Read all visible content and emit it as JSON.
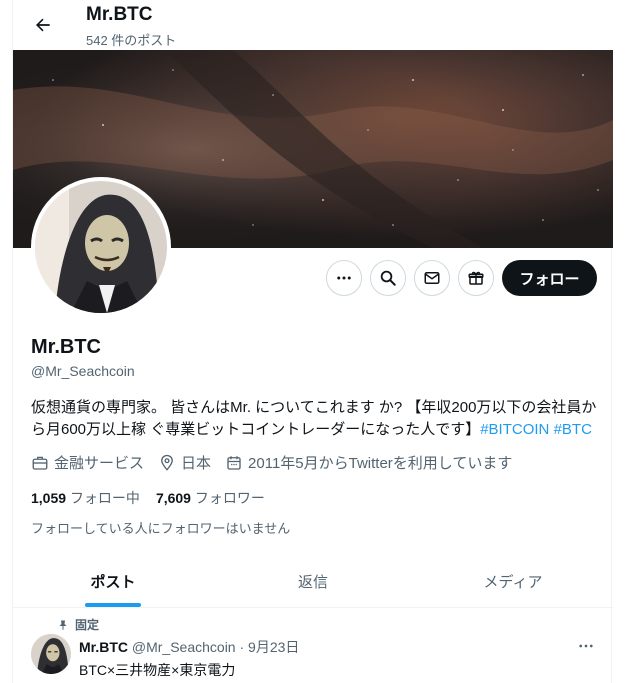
{
  "header": {
    "title": "Mr.BTC",
    "post_count": "542 件のポスト"
  },
  "profile": {
    "name": "Mr.BTC",
    "handle": "@Mr_Seachcoin",
    "bio_text": "仮想通貨の専門家。 皆さんはMr. についてこれます か? 【年収200万以下の会社員から月600万以上稼 ぐ専業ビットコイントレーダーになった人です】",
    "bio_tags": [
      "#BITCOIN",
      "#BTC"
    ],
    "category": "金融サービス",
    "location": "日本",
    "joined": "2011年5月からTwitterを利用しています",
    "following_count": "1,059",
    "following_label": "フォロー中",
    "followers_count": "7,609",
    "followers_label": "フォロワー",
    "followers_note": "フォローしている人にフォロワーはいません"
  },
  "actions": {
    "more_icon": "ellipsis-icon",
    "search_icon": "search-icon",
    "message_icon": "mail-icon",
    "subscribe_icon": "gift-icon",
    "follow_label": "フォロー"
  },
  "tabs": [
    {
      "label": "ポスト",
      "active": true
    },
    {
      "label": "返信",
      "active": false
    },
    {
      "label": "メディア",
      "active": false
    }
  ],
  "pinned_tweet": {
    "pinned_label": "固定",
    "name": "Mr.BTC",
    "handle": "@Mr_Seachcoin",
    "separator": "·",
    "date": "9月23日",
    "text": "BTC×三井物産×東京電力"
  },
  "colors": {
    "accent": "#1d9bf0",
    "text_primary": "#0f1419",
    "text_secondary": "#536471",
    "border": "#cfd9de"
  }
}
